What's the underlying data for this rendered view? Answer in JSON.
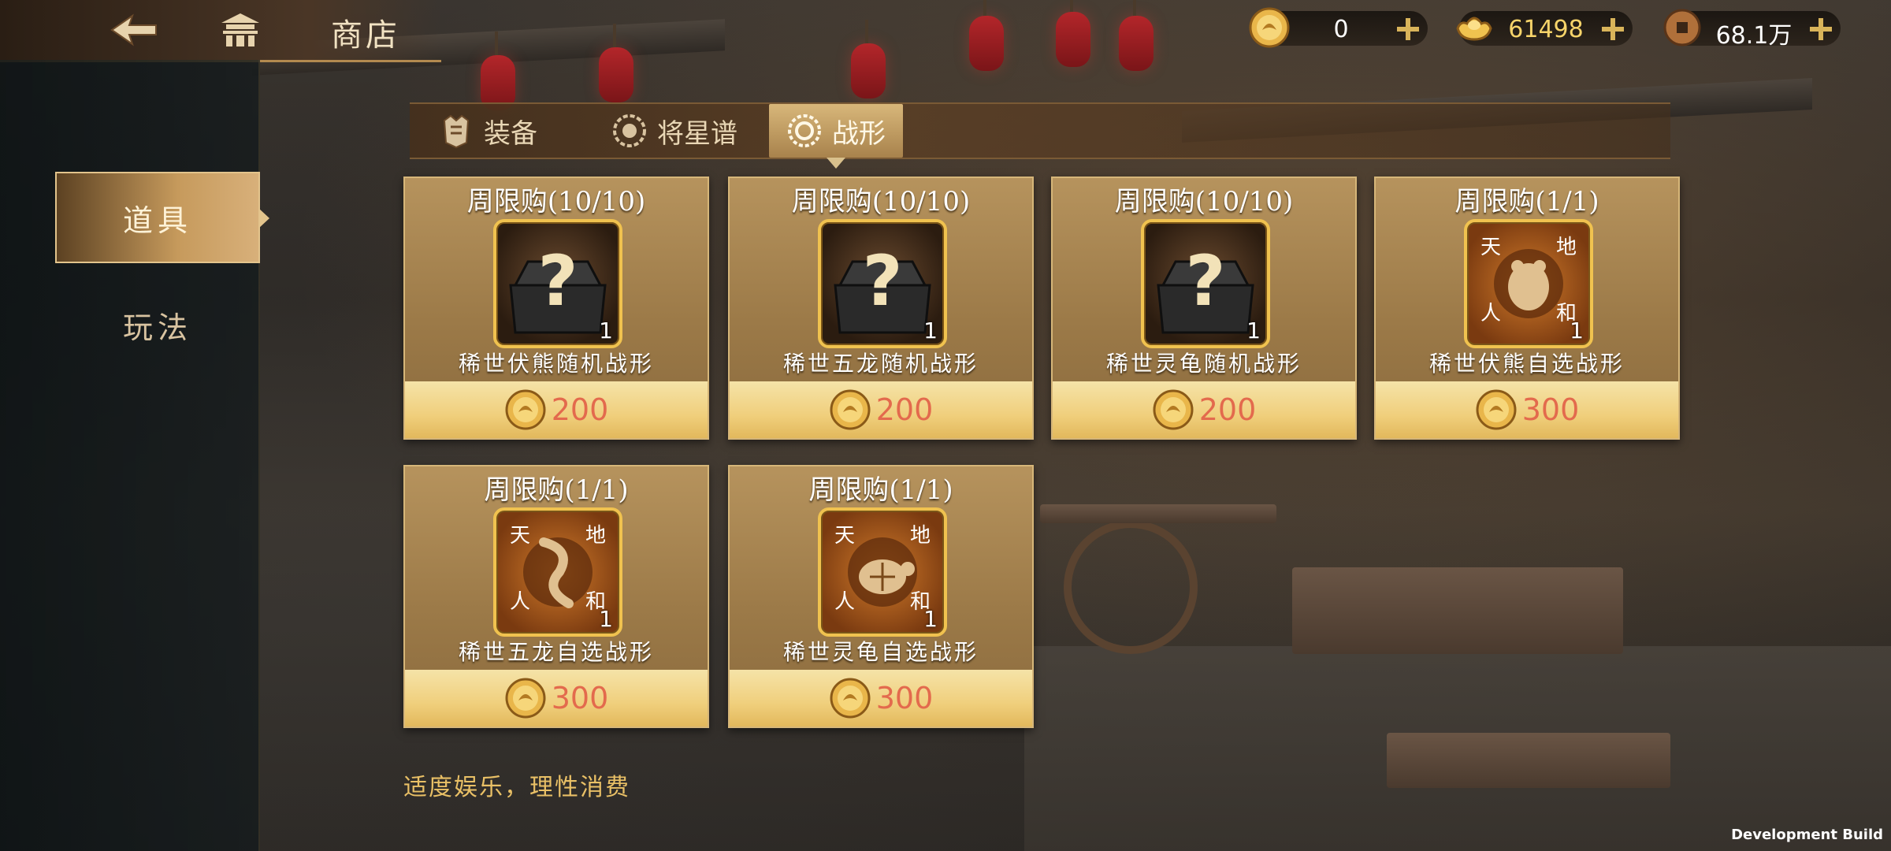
{
  "header": {
    "title": "商店",
    "back_icon": "back-arrow-icon",
    "home_icon": "palace-home-icon"
  },
  "currencies": [
    {
      "name": "gold-coin",
      "value": "0"
    },
    {
      "name": "gold-ingot",
      "value": "61498"
    },
    {
      "name": "copper-coin",
      "value": "68.1万"
    }
  ],
  "tabs": [
    {
      "label": "装备",
      "active": false
    },
    {
      "label": "将星谱",
      "active": false
    },
    {
      "label": "战形",
      "active": true
    }
  ],
  "sidebar": {
    "items": [
      {
        "label": "道具",
        "active": true
      },
      {
        "label": "玩法",
        "active": false
      }
    ]
  },
  "items": [
    {
      "limit": "周限购(10/10)",
      "name": "稀世伏熊随机战形",
      "count": "1",
      "price": "200",
      "icon": "mystery-chest-icon"
    },
    {
      "limit": "周限购(10/10)",
      "name": "稀世五龙随机战形",
      "count": "1",
      "price": "200",
      "icon": "mystery-chest-icon"
    },
    {
      "limit": "周限购(10/10)",
      "name": "稀世灵龟随机战形",
      "count": "1",
      "price": "200",
      "icon": "mystery-chest-icon"
    },
    {
      "limit": "周限购(1/1)",
      "name": "稀世伏熊自选战形",
      "count": "1",
      "price": "300",
      "icon": "bear-formation-icon"
    },
    {
      "limit": "周限购(1/1)",
      "name": "稀世五龙自选战形",
      "count": "1",
      "price": "300",
      "icon": "dragon-formation-icon"
    },
    {
      "limit": "周限购(1/1)",
      "name": "稀世灵龟自选战形",
      "count": "1",
      "price": "300",
      "icon": "turtle-formation-icon"
    }
  ],
  "seal_chars": [
    "天",
    "地",
    "人",
    "和"
  ],
  "notice": "适度娱乐，理性消费",
  "dev_build": "Development Build",
  "colors": {
    "accent_gold": "#e3c48c",
    "price_red": "#e36a4d",
    "gold_value": "#f7d46a"
  }
}
